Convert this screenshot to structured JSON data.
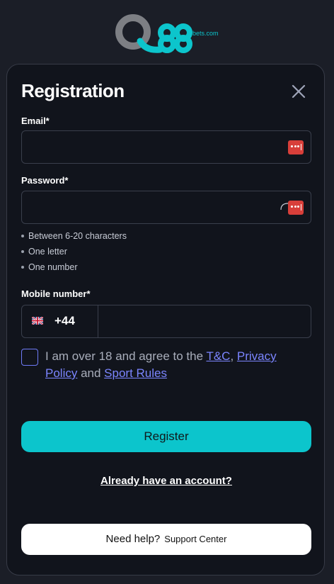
{
  "logo": {
    "main": "Q88",
    "suffix": "bets.com"
  },
  "colors": {
    "accent": "#0cc5cc",
    "link": "#7b85ff",
    "background": "#11141c",
    "password_icon": "#d83f3a"
  },
  "form": {
    "title": "Registration",
    "close_icon": "close-icon",
    "email": {
      "label": "Email*",
      "value": "",
      "placeholder": ""
    },
    "password": {
      "label": "Password*",
      "value": "",
      "placeholder": "",
      "manager_icon": "password-manager-icon",
      "rules": [
        "Between 6-20 characters",
        "One letter",
        "One number"
      ]
    },
    "mobile": {
      "label": "Mobile number*",
      "country_flag": "uk-flag-icon",
      "country_code": "+44",
      "value": "",
      "placeholder": ""
    },
    "agreement": {
      "checked": false,
      "text_before": "I am over 18 and agree to the ",
      "tc_link": "T&C",
      "comma": ", ",
      "privacy_link": "Privacy Policy",
      "and": " and ",
      "sport_rules_link": "Sport Rules"
    },
    "register_label": "Register",
    "login_link": "Already have an account?",
    "help": {
      "question": "Need help?",
      "link": "Support Center"
    }
  }
}
